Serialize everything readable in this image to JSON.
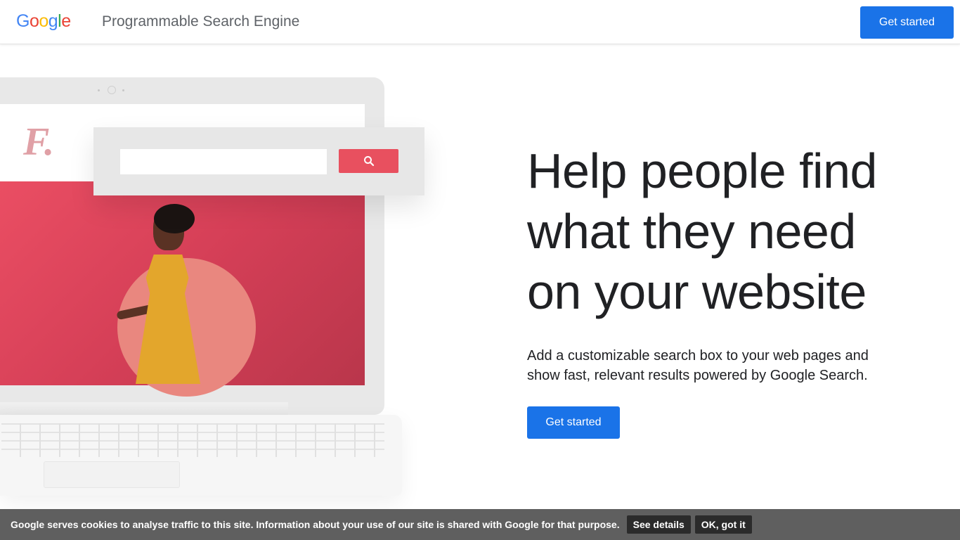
{
  "header": {
    "logo": {
      "letters": [
        "G",
        "o",
        "o",
        "g",
        "l",
        "e"
      ],
      "colors": [
        "#4285f4",
        "#ea4335",
        "#fbbc05",
        "#4285f4",
        "#34a853",
        "#ea4335"
      ]
    },
    "product_name": "Programmable Search Engine",
    "cta_label": "Get started"
  },
  "illustration": {
    "brand_mark": "F.",
    "search_icon": "search-icon",
    "accent_color": "#e8505f"
  },
  "hero": {
    "title_lines": [
      "Help people find",
      "what they need",
      "on your website"
    ],
    "subtitle": "Add a customizable search box to your web pages and show fast, relevant results powered by Google Search.",
    "cta_label": "Get started"
  },
  "cookie_bar": {
    "text": "Google serves cookies to analyse traffic to this site. Information about your use of our site is shared with Google for that purpose.",
    "details_label": "See details",
    "ok_label": "OK, got it"
  },
  "colors": {
    "primary_button": "#1a73e8",
    "cookie_bar_bg": "#5f5f5f",
    "cookie_button_bg": "#2b2b2b"
  }
}
